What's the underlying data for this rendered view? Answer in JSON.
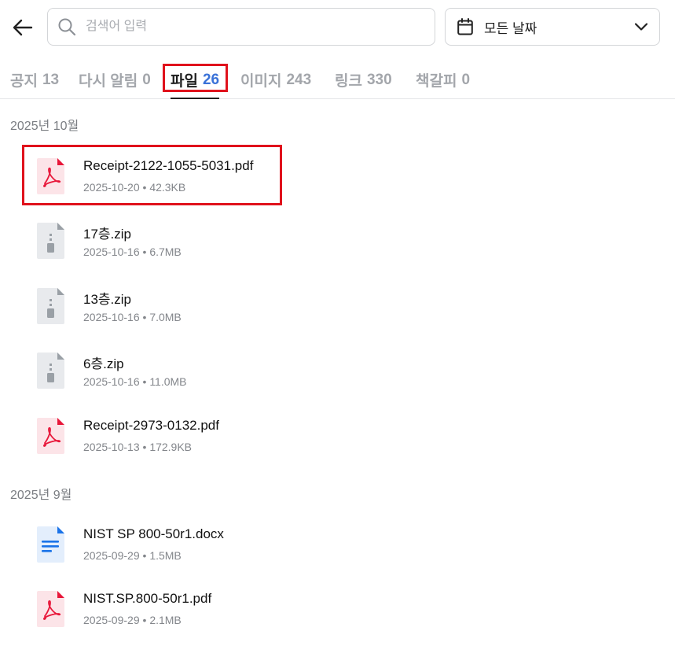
{
  "search": {
    "placeholder": "검색어 입력",
    "value": ""
  },
  "date_filter": {
    "selected": "모든 날짜"
  },
  "tabs": [
    {
      "label": "공지",
      "count": "13",
      "active": false
    },
    {
      "label": "다시 알림",
      "count": "0",
      "active": false
    },
    {
      "label": "파일",
      "count": "26",
      "active": true
    },
    {
      "label": "이미지",
      "count": "243",
      "active": false
    },
    {
      "label": "링크",
      "count": "330",
      "active": false
    },
    {
      "label": "책갈피",
      "count": "0",
      "active": false
    }
  ],
  "sections": [
    {
      "title": "2025년 10월",
      "files": [
        {
          "name": "Receipt-2122-1055-5031.pdf",
          "date": "2025-10-20",
          "size": "42.3KB",
          "icon": "pdf-icon",
          "highlighted": true
        },
        {
          "name": "17층.zip",
          "date": "2025-10-16",
          "size": "6.7MB",
          "icon": "zip-icon"
        },
        {
          "name": "13층.zip",
          "date": "2025-10-16",
          "size": "7.0MB",
          "icon": "zip-icon"
        },
        {
          "name": "6층.zip",
          "date": "2025-10-16",
          "size": "11.0MB",
          "icon": "zip-icon"
        },
        {
          "name": "Receipt-2973-0132.pdf",
          "date": "2025-10-13",
          "size": "172.9KB",
          "icon": "pdf-icon"
        }
      ]
    },
    {
      "title": "2025년 9월",
      "files": [
        {
          "name": "NIST SP 800-50r1.docx",
          "date": "2025-09-29",
          "size": "1.5MB",
          "icon": "docx-icon"
        },
        {
          "name": "NIST.SP.800-50r1.pdf",
          "date": "2025-09-29",
          "size": "2.1MB",
          "icon": "pdf-icon"
        }
      ]
    }
  ],
  "meta_separator": " • ",
  "colors": {
    "accent": "#3a72d8",
    "highlight": "#e0121c",
    "pdf": "#e8173a",
    "docx": "#1a73e8",
    "zip": "#9aa0a6"
  }
}
